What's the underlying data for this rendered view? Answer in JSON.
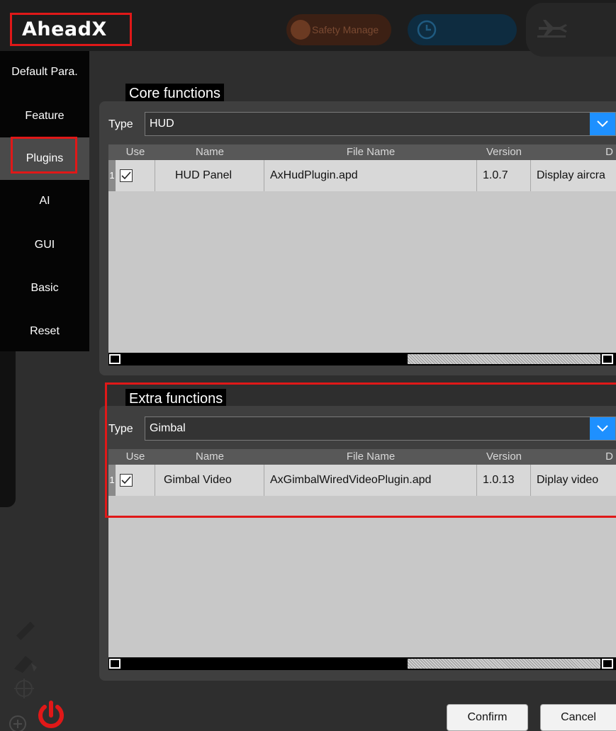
{
  "app": {
    "logo": "AheadX"
  },
  "topbar": {
    "safety_label": "Safety Manage",
    "icons": [
      "safety-icon",
      "clock-icon",
      "airplane-icon"
    ]
  },
  "sidebar": {
    "items": [
      {
        "label": "Default Para."
      },
      {
        "label": "Feature"
      },
      {
        "label": "Plugins",
        "active": true
      },
      {
        "label": "AI"
      },
      {
        "label": "GUI"
      },
      {
        "label": "Basic"
      },
      {
        "label": "Reset"
      }
    ],
    "bottom_icons": [
      "ruler-icon",
      "eraser-icon",
      "crosshair-icon",
      "zoom-in-icon",
      "power-icon"
    ]
  },
  "core": {
    "title": "Core functions",
    "type_label": "Type",
    "type_value": "HUD",
    "columns": [
      "Use",
      "Name",
      "File Name",
      "Version",
      "D"
    ],
    "rows": [
      {
        "num": "1",
        "use": true,
        "name": "HUD Panel",
        "file": "AxHudPlugin.apd",
        "version": "1.0.7",
        "desc": "Display aircra"
      }
    ]
  },
  "extra": {
    "title": "Extra functions",
    "type_label": "Type",
    "type_value": "Gimbal",
    "columns": [
      "Use",
      "Name",
      "File Name",
      "Version",
      "D"
    ],
    "rows": [
      {
        "num": "1",
        "use": true,
        "name": "Gimbal Video",
        "file": "AxGimbalWiredVideoPlugin.apd",
        "version": "1.0.13",
        "desc": "Diplay video"
      }
    ]
  },
  "footer": {
    "confirm": "Confirm",
    "cancel": "Cancel"
  },
  "colors": {
    "accent": "#1e90ff",
    "highlight": "#e01818",
    "power": "#e01818"
  }
}
